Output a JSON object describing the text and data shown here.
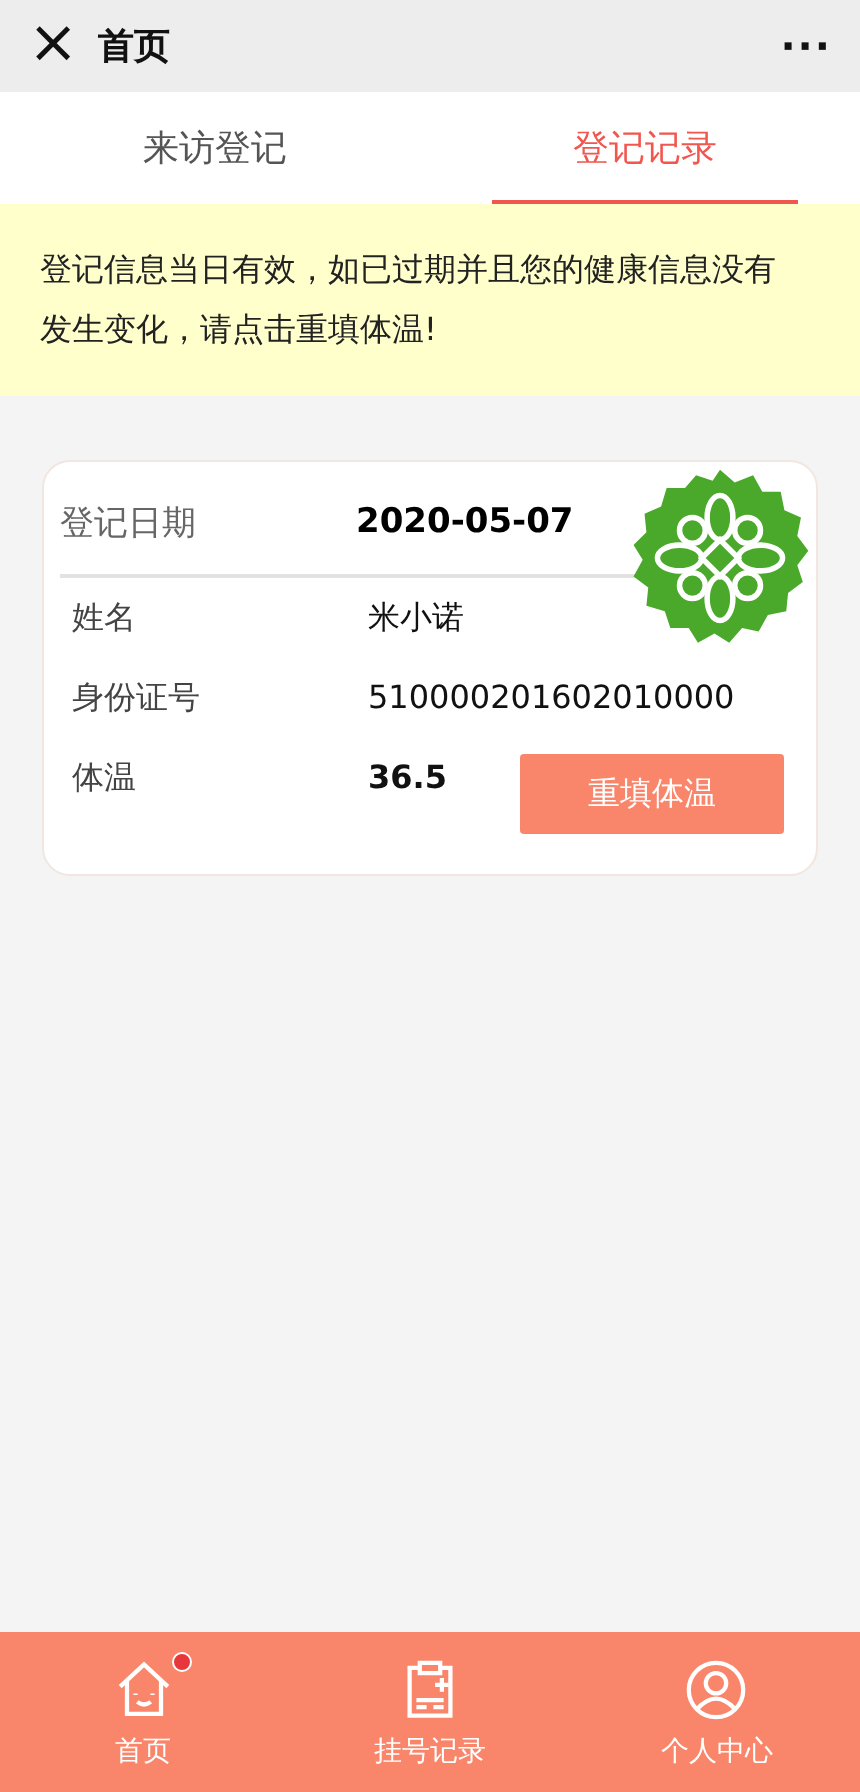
{
  "top_bar": {
    "close": "×",
    "title": "首页",
    "more": "···"
  },
  "tabs": [
    {
      "label": "来访登记",
      "selected": false
    },
    {
      "label": "登记记录",
      "selected": true
    }
  ],
  "notice": "登记信息当日有效，如已过期并且您的健康信息没有发生变化，请点击重填体温!",
  "record": {
    "date_label": "登记日期",
    "date": "2020-05-07",
    "stamp": true,
    "fields": [
      {
        "label": "姓名",
        "value": "米小诺",
        "bold": false
      },
      {
        "label": "身份证号",
        "value": "510000201602010000",
        "bold": false
      },
      {
        "label": "体温",
        "value": "36.5",
        "bold": true
      }
    ],
    "action": "重填体温"
  },
  "bottom_nav": [
    {
      "kind": "home",
      "label": "首页",
      "badge": true
    },
    {
      "kind": "record",
      "label": "挂号记录",
      "badge": false
    },
    {
      "kind": "user",
      "label": "个人中心",
      "badge": false
    }
  ]
}
